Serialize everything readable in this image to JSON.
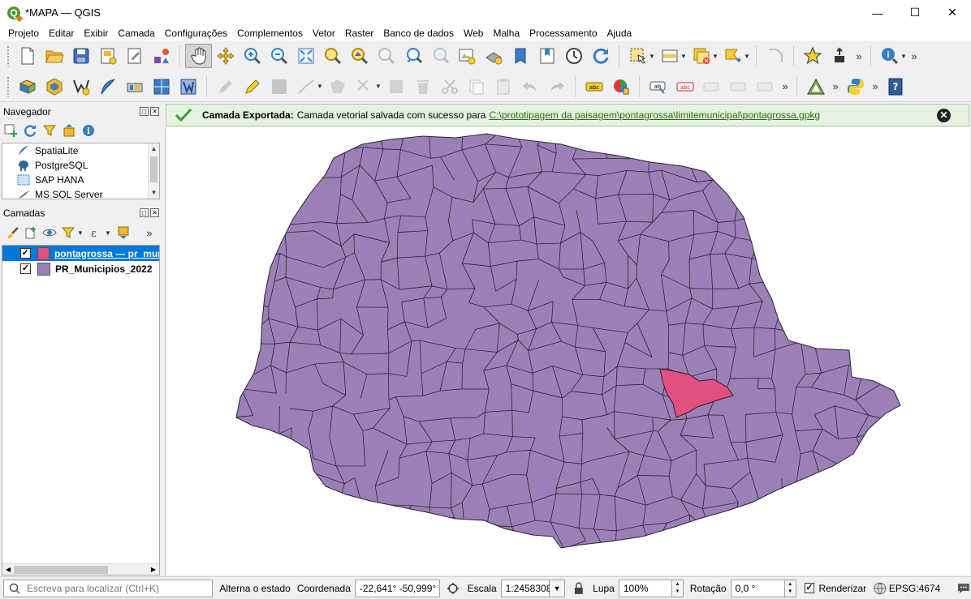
{
  "window": {
    "title": "*MAPA — QGIS",
    "minimize": "—",
    "maximize": "☐",
    "close": "✕"
  },
  "menu": [
    "Projeto",
    "Editar",
    "Exibir",
    "Camada",
    "Configurações",
    "Complementos",
    "Vetor",
    "Raster",
    "Banco de dados",
    "Web",
    "Malha",
    "Processamento",
    "Ajuda"
  ],
  "navigator": {
    "title": "Navegador",
    "items": [
      "SpatiaLite",
      "PostgreSQL",
      "SAP HANA",
      "MS SQL Server"
    ]
  },
  "layers": {
    "title": "Camadas",
    "items": [
      {
        "name": "pontagrossa — pr_mun",
        "color": "#e1507f",
        "checked": true,
        "selected": true
      },
      {
        "name": "PR_Municipios_2022",
        "color": "#9b80b7",
        "checked": true,
        "selected": false
      }
    ]
  },
  "message": {
    "title": "Camada Exportada:",
    "text": "Camada vetorial salvada com sucesso para",
    "link": "C:\\prototipagem da paisagem\\pontagrossa\\limitemunicipal\\pontagrossa.gpkg"
  },
  "map": {
    "fill_color": "#9b80b7",
    "highlight_color": "#e1507f",
    "stroke_color": "#2b2233"
  },
  "status": {
    "locator_placeholder": "Escreva para localizar (Ctrl+K)",
    "toggle_label": "Alterna o estado",
    "coord_label": "Coordenada",
    "coord_value": "-22,641° -50,999°",
    "scale_label": "Escala",
    "scale_value": "1:2458308",
    "magnifier_label": "Lupa",
    "magnifier_value": "100%",
    "rotation_label": "Rotação",
    "rotation_value": "0,0 °",
    "render_label": "Renderizar",
    "crs": "EPSG:4674"
  }
}
